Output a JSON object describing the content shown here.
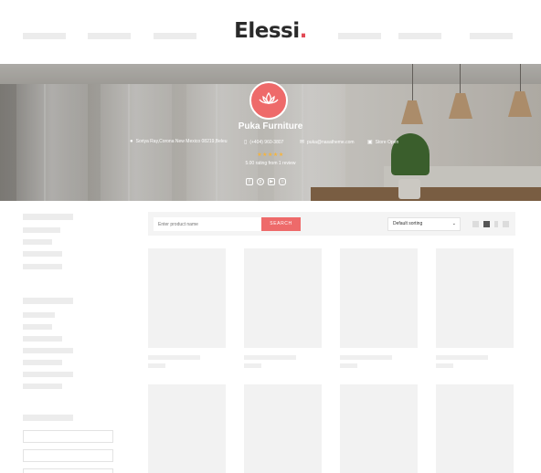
{
  "header": {
    "logo_text": "Elessi",
    "logo_dot": ".",
    "logo_accent_color": "#e24a55"
  },
  "store": {
    "name": "Puka Furniture",
    "address": "Soriya Ray,Corona New Mexico 08219,Beleu",
    "phone": "(+404) 960-3807",
    "email": "puka@nasatheme.com",
    "status": "Store Open",
    "stars": "★★★★★",
    "rating_text": "5.00 rating from 1 review",
    "icons": {
      "address": "map-pin-icon",
      "phone": "phone-icon",
      "email": "envelope-icon",
      "status": "cart-icon",
      "avatar": "lotus-icon"
    },
    "accent_color": "#ee6a6a",
    "socials": [
      "facebook-icon",
      "pinterest-icon",
      "youtube-icon",
      "instagram-icon"
    ]
  },
  "toolbar": {
    "search_placeholder": "Enter product name",
    "search_button": "SEARCH",
    "sort_selected": "Default sorting",
    "view_modes": [
      "grid-2-icon",
      "grid-3-icon",
      "grid-4-icon",
      "list-icon"
    ],
    "active_view": "grid-3-icon"
  }
}
